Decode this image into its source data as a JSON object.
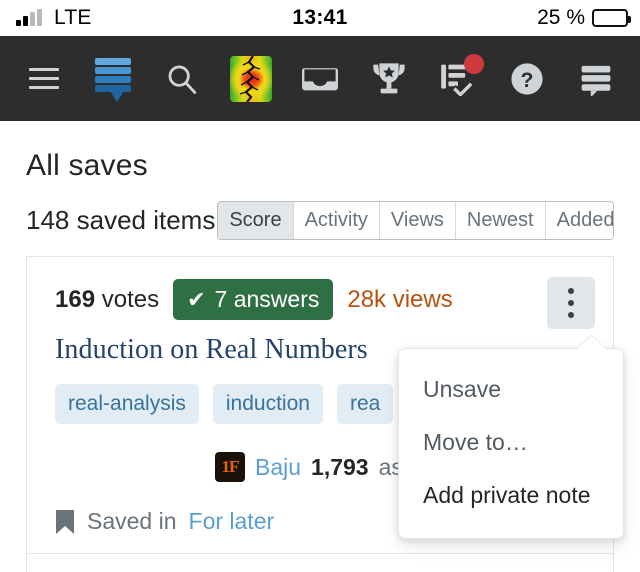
{
  "statusbar": {
    "carrier": "LTE",
    "time": "13:41",
    "battery_percent": "25 %",
    "signal_icon": "signal-bars-icon",
    "battery_icon": "battery-icon"
  },
  "navbar": {
    "background": "#2d2d2d",
    "items": [
      {
        "name": "hamburger-menu-icon",
        "label": "Menu"
      },
      {
        "name": "stack-exchange-logo",
        "label": "Stack Exchange"
      },
      {
        "name": "search-icon",
        "label": "Search"
      },
      {
        "name": "avatar-icon",
        "label": "Profile"
      },
      {
        "name": "inbox-icon",
        "label": "Inbox"
      },
      {
        "name": "trophy-icon",
        "label": "Achievements"
      },
      {
        "name": "review-icon",
        "label": "Review",
        "badge": true
      },
      {
        "name": "help-icon",
        "label": "Help"
      },
      {
        "name": "chat-icon",
        "label": "Chat"
      }
    ],
    "badge_color": "#d0393e"
  },
  "page": {
    "title": "All saves",
    "saved_count": "148 saved items",
    "tabs": [
      {
        "label": "Score",
        "selected": true
      },
      {
        "label": "Activity",
        "selected": false
      },
      {
        "label": "Views",
        "selected": false
      },
      {
        "label": "Newest",
        "selected": false
      },
      {
        "label": "Added",
        "selected": false
      }
    ]
  },
  "card": {
    "votes": "169",
    "votes_label": "votes",
    "answers_badge": {
      "check": "✔",
      "text": "7 answers",
      "color": "#2f6f44"
    },
    "views": "28k views",
    "views_color": "#b8500f",
    "question_title": "Induction on Real Numbers",
    "tags": [
      "real-analysis",
      "induction",
      "rea"
    ],
    "user": {
      "avatar_icon": "user-avatar",
      "avatar_text": "1F",
      "name": "Baju",
      "reputation": "1,793",
      "action": "aske"
    },
    "saved": {
      "bookmark_icon": "bookmark-icon",
      "label": "Saved in",
      "list_name": "For later"
    },
    "kebab_icon": "kebab-menu-icon"
  },
  "popup": {
    "items": [
      {
        "label": "Unsave",
        "style": "muted"
      },
      {
        "label": "Move to…",
        "style": "muted"
      },
      {
        "label": "Add private note",
        "style": "dark"
      }
    ]
  }
}
